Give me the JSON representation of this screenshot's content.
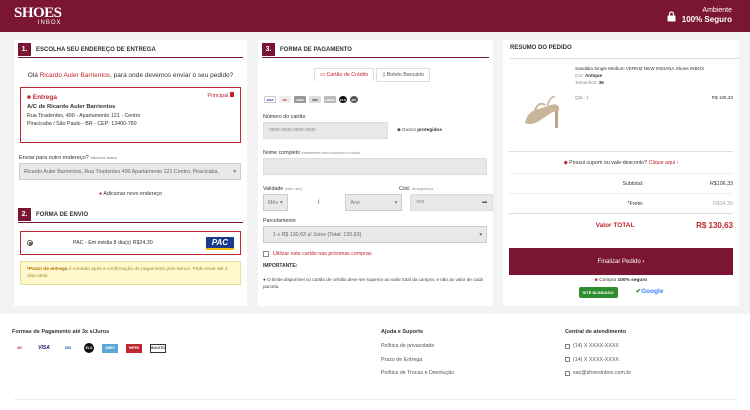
{
  "header": {
    "logo_main": "SHOES",
    "logo_sub": "INBOX",
    "secure_line1": "Ambiente",
    "secure_line2": "100% Seguro"
  },
  "delivery": {
    "num": "1.",
    "title": "ESCOLHA SEU ENDEREÇO DE ENTREGA",
    "greet_pre": "Olá ",
    "user": "Ricardo Auler Barrientos",
    "greet_post": ", para onde devemos enviar o seu pedido?",
    "addr_tag": "Principal",
    "addr_name": "Entrega",
    "addr_to": "A/C de Ricardo Auler Barrientos",
    "addr_line1": "Rua Tiradentes, 490 - Apartamento 121 - Centro",
    "addr_line2": "Piracicaba / São Paulo - BR - CEP: 13400-760",
    "other_label": "Enviar para outro endereço?",
    "other_hint": "Selecione abaixo",
    "select_value": "Ricardo Auler Barrientos, Rua Tiradentes 490 Apartamento 121 Centro, Piracicaba,",
    "add_new": "Adicionar novo endereço"
  },
  "shipping": {
    "num": "2.",
    "title": "FORMA DE ENVIO",
    "option": "PAC - Em média 8 dia(s) R$24,30",
    "carrier": "PAC",
    "warn_bold": "*Prazo de entrega",
    "warn_text": " é contado após a confirmação de pagamento pelo banco. Pode levar até 3 dias úteis."
  },
  "payment": {
    "num": "3.",
    "title": "FORMA DE PAGAMENTO",
    "tab_card": "Cartão de Crédito",
    "tab_boleto": "Boleto Bancário",
    "card_number_label": "Número do cartão",
    "card_number_placeholder": "0000 0000 0000 0000",
    "protected_pre": "Dados ",
    "protected_bold": "protegidos",
    "name_label": "Nome completo",
    "name_hint": "exatamente como impresso no cartão",
    "validity_label": "Validade",
    "validity_hint": "(mês / ano)",
    "month": "Mês",
    "year": "Ano",
    "sep": "/",
    "cvv_label": "Cód.",
    "cvv_hint": "de segurança",
    "cvv_placeholder": "000",
    "installments_label": "Parcelamento",
    "installments_value": "1 x R$ 130,63 s/ Juros (Total: 130,63)",
    "save_card": "Utilizar este cartão nas próximas compras",
    "important": "IMPORTANTE:",
    "note": "O limite disponível no cartão de crédito deve ser superior ao valor total da compra, e não ao valor de cada parcela.",
    "cards": [
      "VISA",
      "MC",
      "AMEX",
      "DIN",
      "HIPER",
      "ELO",
      "MC"
    ]
  },
  "summary": {
    "title": "RESUMO DO PEDIDO",
    "product_name": "Sandália Single Medium VERNIZ NEW INDIANA Shoes INBOX",
    "color_label": "Cor: ",
    "color": "Antique",
    "size_label": "Tamanhos: ",
    "size": "36",
    "qty": "Qtd.: 1",
    "price": "R$ 106,33",
    "coupon_text": "Possui cupom ou vale-desconto? ",
    "coupon_link": "Clique aqui",
    "subtotal_label": "Subtotal:",
    "subtotal": "R$106,33",
    "freight_label": "*Frete:",
    "freight": "R$24,30",
    "total_label": "Valor TOTAL",
    "total": "R$ 130,63",
    "button": "Finalizar Pedido",
    "safe_pre": "Compra ",
    "safe_bold": "100% seguro",
    "badge1": "SITE BLINDADO",
    "badge2": "Google"
  },
  "footer": {
    "pay_title": "Formas de Pagamento até 3x s/Juros",
    "pay_cards": [
      "MC",
      "VISA",
      "DIN",
      "ELO",
      "AMEX",
      "HIPER",
      "BOLETO"
    ],
    "help_title": "Ajuda e Suporte",
    "help_links": [
      "Política de privacidade",
      "Prazo de Entrega",
      "Política de Trocas e Devolução"
    ],
    "contact_title": "Central de atendimento",
    "contacts": [
      "(14) X XXXX-XXXX",
      "(14) X XXXX-XXXX",
      "sac@shoesinbox.com.br"
    ]
  }
}
